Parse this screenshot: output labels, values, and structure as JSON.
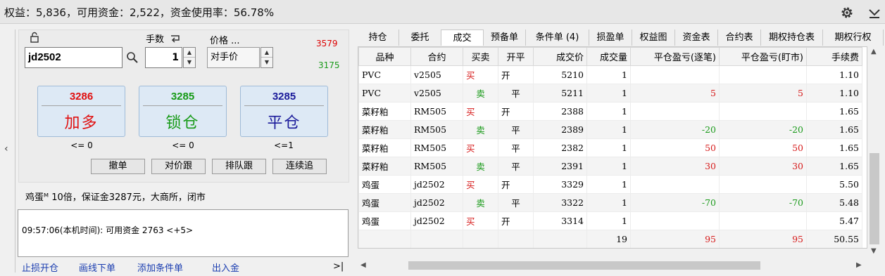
{
  "summary": "权益：5,836，可用资金：2,522，资金使用率：56.78%",
  "icons": [
    "gear-icon",
    "chevron-down-icon",
    "lock-icon",
    "search-icon",
    "swap-icon",
    "chevron-left-icon"
  ],
  "order": {
    "qty_label": "手数",
    "price_label": "价格 ...",
    "code_value": "jd2502",
    "qty_value": "1",
    "price_value": "对手价",
    "limit_up": "3579",
    "limit_down": "3175",
    "buttons": [
      {
        "price": "3286",
        "label": "加多",
        "color": "#e01010",
        "limit": "<= 0"
      },
      {
        "price": "3285",
        "label": "锁仓",
        "color": "#169a16",
        "limit": "<= 0"
      },
      {
        "price": "3285",
        "label": "平仓",
        "color": "#1a1a9a",
        "limit": "<=1"
      }
    ],
    "small_buttons": [
      "撤单",
      "对价跟",
      "排队跟",
      "连续追"
    ]
  },
  "info": "鸡蛋ᴹ 10倍，保证金3287元，大商所，闭市",
  "message": "09:57:06(本机时间): 可用资金 2763  <+5>",
  "links": [
    "止损开仓",
    "画线下单",
    "添加条件单",
    "出入金"
  ],
  "collapse_label": ">|",
  "tabs": [
    "持仓",
    "委托",
    "成交",
    "预备单",
    "条件单 (4)",
    "损盈单",
    "权益图",
    "资金表",
    "合约表",
    "期权持仓表",
    "期权行权"
  ],
  "active_tab": "成交",
  "table": {
    "columns": [
      "品种",
      "合约",
      "买卖",
      "开平",
      "成交价",
      "成交量",
      "平仓盈亏(逐笔)",
      "平仓盈亏(盯市)",
      "手续费"
    ],
    "rows": [
      [
        "PVC",
        "v2505",
        "买",
        "开",
        "5210",
        "1",
        "",
        "",
        "1.10"
      ],
      [
        "PVC",
        "v2505",
        "卖",
        "平",
        "5211",
        "1",
        "5",
        "5",
        "1.10"
      ],
      [
        "菜籽粕",
        "RM505",
        "买",
        "开",
        "2388",
        "1",
        "",
        "",
        "1.65"
      ],
      [
        "菜籽粕",
        "RM505",
        "卖",
        "平",
        "2389",
        "1",
        "-20",
        "-20",
        "1.65"
      ],
      [
        "菜籽粕",
        "RM505",
        "买",
        "平",
        "2382",
        "1",
        "50",
        "50",
        "1.65"
      ],
      [
        "菜籽粕",
        "RM505",
        "卖",
        "平",
        "2391",
        "1",
        "30",
        "30",
        "1.65"
      ],
      [
        "鸡蛋",
        "jd2502",
        "买",
        "开",
        "3329",
        "1",
        "",
        "",
        "5.50"
      ],
      [
        "鸡蛋",
        "jd2502",
        "卖",
        "平",
        "3322",
        "1",
        "-70",
        "-70",
        "5.48"
      ],
      [
        "鸡蛋",
        "jd2502",
        "买",
        "开",
        "3314",
        "1",
        "",
        "",
        "5.47"
      ]
    ],
    "total": [
      "",
      "",
      "",
      "",
      "",
      "19",
      "95",
      "95",
      "50.55"
    ]
  },
  "colors": {
    "buy": "#d61a1a",
    "sell": "#1a9a1a",
    "accent": "#dde9f5"
  }
}
